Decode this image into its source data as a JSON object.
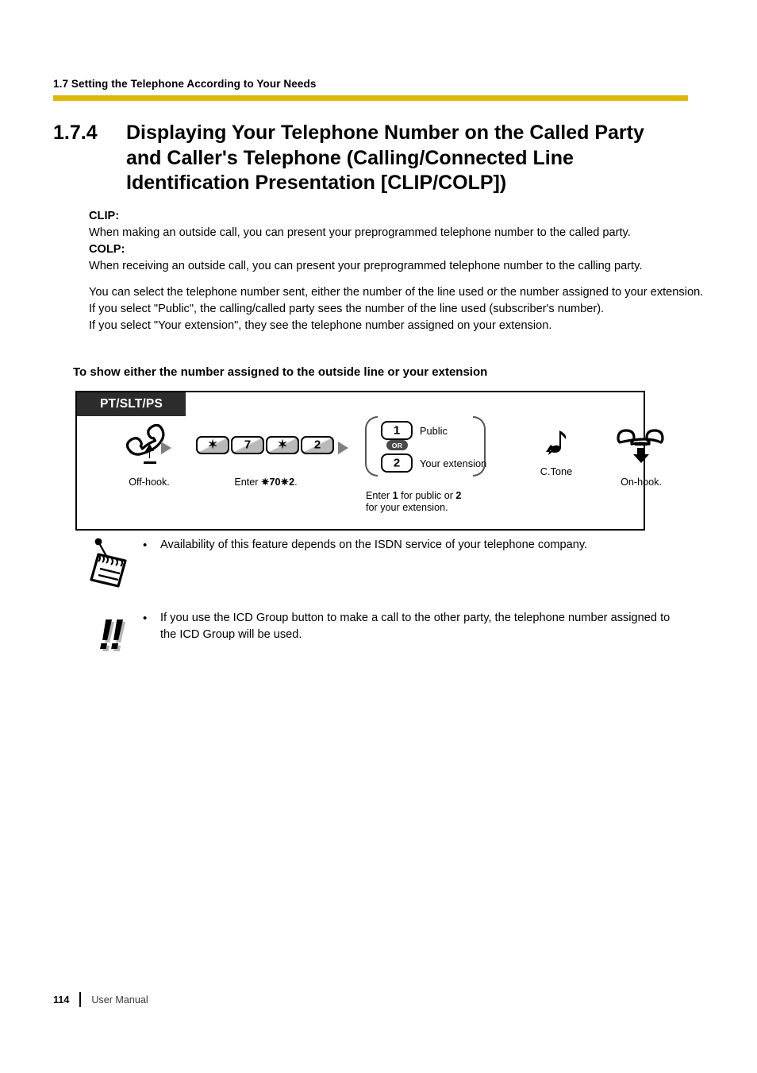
{
  "page": {
    "running_head": "1.7 Setting the Telephone According to Your Needs",
    "rule_color": "#ddb80b",
    "footer": {
      "page_number": "114",
      "document_name": "User Manual"
    }
  },
  "heading": {
    "number": "1.7.4",
    "title": "Displaying Your Telephone Number on the Called Party and Caller's Telephone (Calling/Connected Line Identification Presentation [CLIP/COLP])"
  },
  "body": {
    "clip_label": "CLIP:",
    "clip_text": "When making an outside call, you can present your preprogrammed telephone number to the called party.",
    "colp_label": "COLP:",
    "colp_text": "When receiving an outside call, you can present your preprogrammed telephone number to the calling party.",
    "select_line1": "You can select the telephone number sent, either the number of the line used or the number assigned to your extension.",
    "select_line2": "If you select \"Public\", the calling/called party sees the number of the line used (subscriber's number).",
    "select_line3": "If you select \"Your extension\", they see the telephone number assigned on your extension."
  },
  "subheading": "To show either the number assigned to the outside line or your extension",
  "diagram": {
    "tab_label": "PT/SLT/PS",
    "steps": {
      "offhook_caption": "Off-hook.",
      "enter_caption_prefix": "Enter ",
      "enter_caption_code": "✷70✷2",
      "enter_caption_suffix": ".",
      "keys": [
        "✶",
        "7",
        "✶",
        "2"
      ],
      "option_or": "OR",
      "option1_key": "1",
      "option1_label": "Public",
      "option2_key": "2",
      "option2_label": "Your extension",
      "option_caption_line1_a": "Enter ",
      "option_caption_line1_b": "1",
      "option_caption_line1_c": " for public or ",
      "option_caption_line1_d": "2",
      "option_caption_line2": "for your extension.",
      "ctone_label": "C.Tone",
      "onhook_caption": "On-hook."
    }
  },
  "notes": [
    {
      "bullet": "•",
      "icon": "notepad-pen-icon",
      "text": "Availability of this feature depends on the ISDN service of your telephone company."
    },
    {
      "bullet": "•",
      "icon": "double-exclamation-icon",
      "glyph": "!!",
      "text": "If you use the ICD Group button to make a call to the other party, the telephone number assigned to the ICD Group will be used."
    }
  ]
}
